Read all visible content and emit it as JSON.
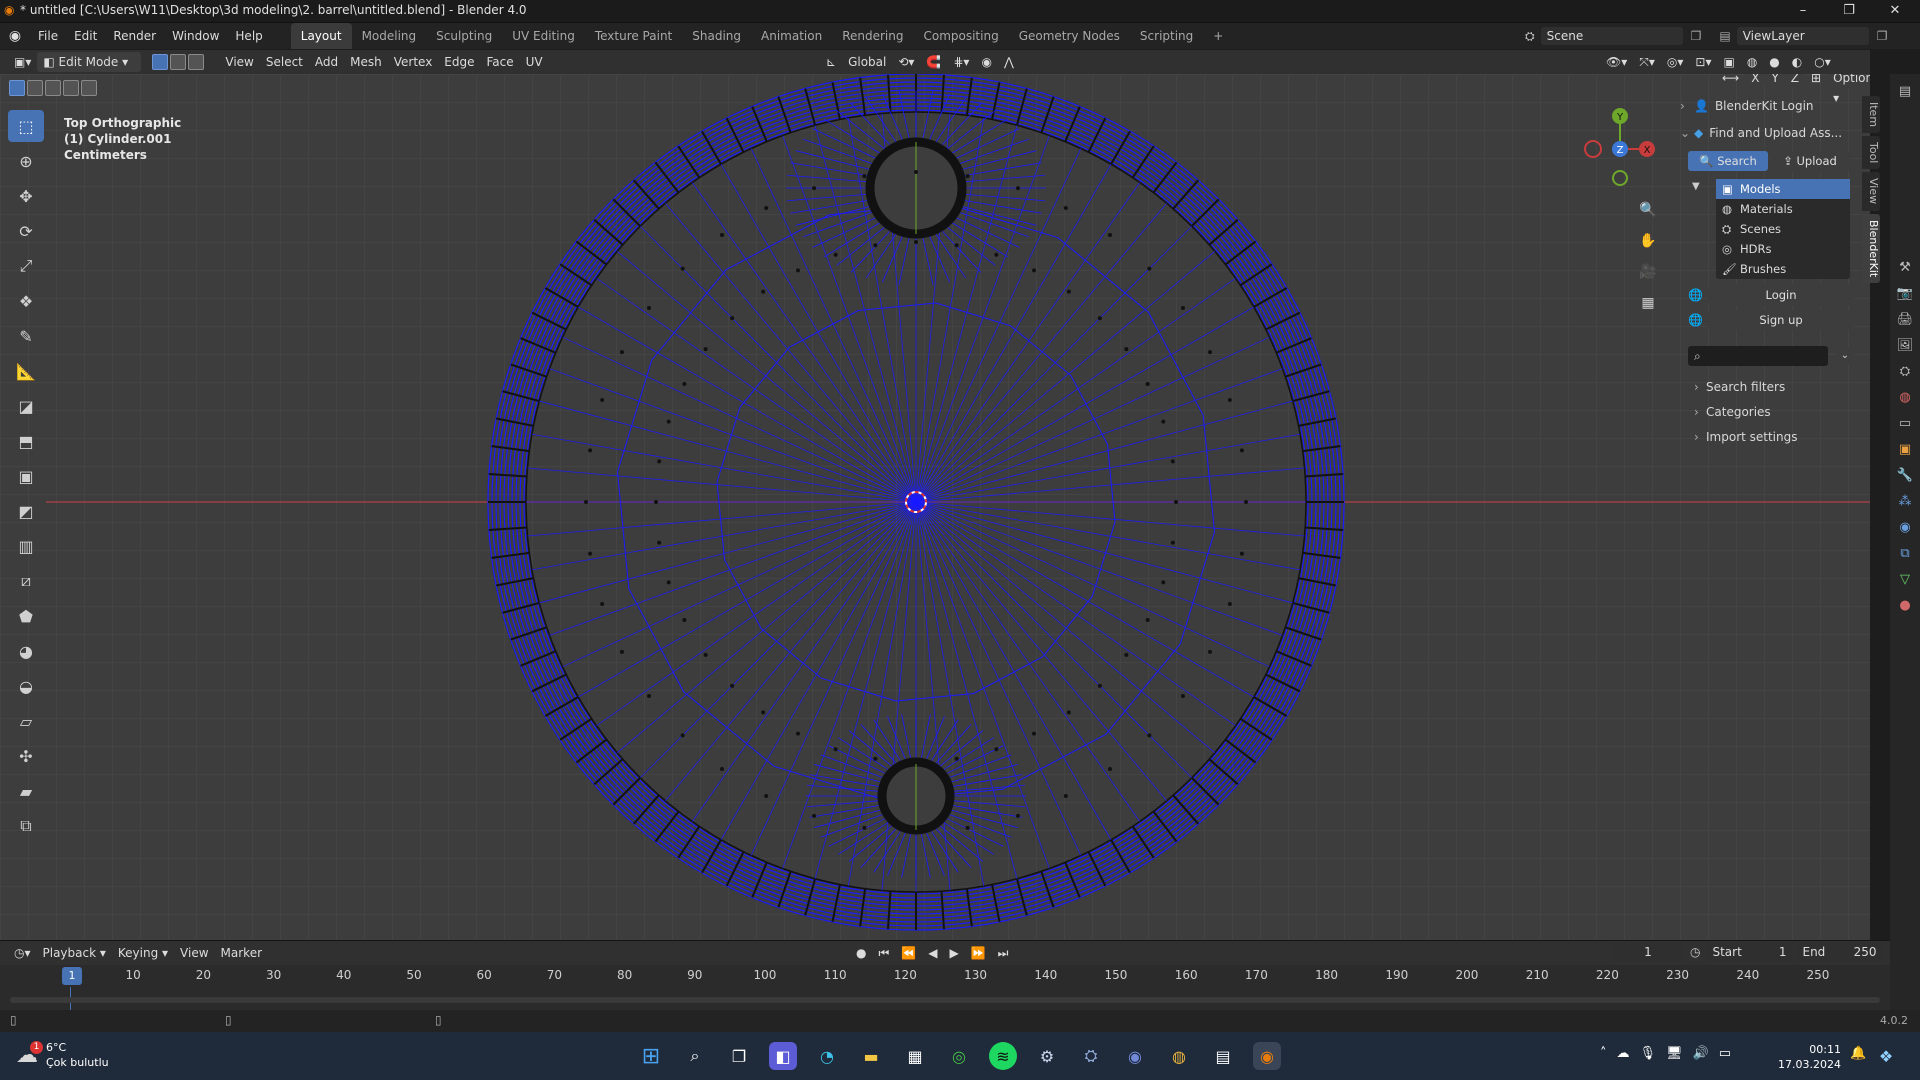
{
  "window": {
    "title": "* untitled [C:\\Users\\W11\\Desktop\\3d modeling\\2. barrel\\untitled.blend] - Blender 4.0",
    "minimize": "–",
    "maximize": "❐",
    "close": "✕"
  },
  "menubar": {
    "menus": [
      "File",
      "Edit",
      "Render",
      "Window",
      "Help"
    ],
    "workspaces": [
      "Layout",
      "Modeling",
      "Sculpting",
      "UV Editing",
      "Texture Paint",
      "Shading",
      "Animation",
      "Rendering",
      "Compositing",
      "Geometry Nodes",
      "Scripting"
    ],
    "active_workspace": "Layout",
    "add_tab": "+",
    "scene_label": "Scene",
    "viewlayer_label": "ViewLayer"
  },
  "viewport_header": {
    "mode": "Edit Mode",
    "menus": [
      "View",
      "Select",
      "Add",
      "Mesh",
      "Vertex",
      "Edge",
      "Face",
      "UV"
    ],
    "transform_orientation": "Global",
    "axes": [
      "X",
      "Y",
      "Z"
    ],
    "options": "Options"
  },
  "viewport": {
    "view_name": "Top Orthographic",
    "object_name": "(1) Cylinder.001",
    "units": "Centimeters",
    "gizmo": {
      "x": "X",
      "y": "Y",
      "z": "Z"
    }
  },
  "npanel": {
    "blenderkit_login": "BlenderKit Login",
    "find_upload": "Find and Upload Ass...",
    "search_btn": "Search",
    "upload_btn": "Upload",
    "asset_types": [
      "Models",
      "Materials",
      "Scenes",
      "HDRs",
      "Brushes"
    ],
    "active_asset_type": "Models",
    "login_btn": "Login",
    "signup_btn": "Sign up",
    "search_placeholder": "",
    "sections": [
      "Search filters",
      "Categories",
      "Import settings"
    ],
    "tabs": [
      "Item",
      "Tool",
      "View",
      "BlenderKit"
    ],
    "active_tab": "BlenderKit"
  },
  "timeline": {
    "menus": [
      "Playback",
      "Keying",
      "View",
      "Marker"
    ],
    "current_frame": "1",
    "start_label": "Start",
    "start": "1",
    "end_label": "End",
    "end": "250",
    "ticks": [
      "10",
      "20",
      "30",
      "40",
      "50",
      "60",
      "70",
      "80",
      "90",
      "100",
      "110",
      "120",
      "130",
      "140",
      "150",
      "160",
      "170",
      "180",
      "190",
      "200",
      "210",
      "220",
      "230",
      "240",
      "250"
    ],
    "playhead": "1"
  },
  "statusbar": {
    "version": "4.0.2"
  },
  "taskbar": {
    "weather_temp": "6°C",
    "weather_desc": "Çok bulutlu",
    "weather_badge": "1",
    "time": "00:11",
    "date": "17.03.2024"
  },
  "colors": {
    "accent": "#4772b3",
    "wire": "#1a1aff",
    "x_axis": "#c83c3c",
    "y_axis": "#6ea82a",
    "z_axis": "#3c78d8"
  }
}
